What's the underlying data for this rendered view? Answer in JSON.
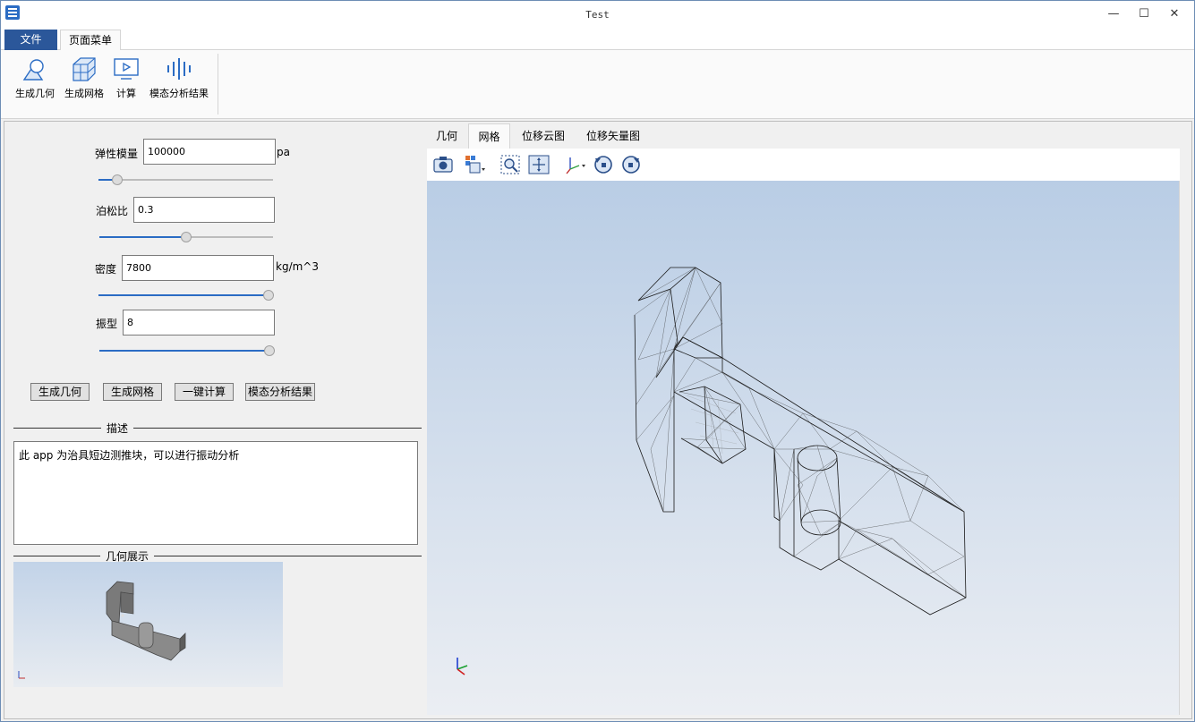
{
  "window": {
    "title": "Test"
  },
  "title_buttons": {
    "minimize": "—",
    "maximize": "☐",
    "close": "✕"
  },
  "menu": {
    "file": "文件",
    "page_menu": "页面菜单"
  },
  "ribbon": {
    "items": [
      {
        "label": "生成几何",
        "icon": "geometry-icon"
      },
      {
        "label": "生成网格",
        "icon": "mesh-icon"
      },
      {
        "label": "计算",
        "icon": "compute-icon"
      },
      {
        "label": "模态分析结果",
        "icon": "modal-result-icon"
      }
    ]
  },
  "params": {
    "elastic_modulus": {
      "label": "弹性模量",
      "value": "100000",
      "unit": "pa",
      "slider_fraction": 0.08
    },
    "poisson_ratio": {
      "label": "泊松比",
      "value": "0.3",
      "slider_fraction": 0.5
    },
    "density": {
      "label": "密度",
      "value": "7800",
      "unit": "kg/m^3",
      "slider_fraction": 1.0
    },
    "mode_shape": {
      "label": "振型",
      "value": "8",
      "slider_fraction": 1.0
    }
  },
  "actions": {
    "gen_geometry": "生成几何",
    "gen_mesh": "生成网格",
    "one_click_compute": "一键计算",
    "modal_result": "模态分析结果"
  },
  "description": {
    "title": "描述",
    "text": "此 app 为治具短边测推块，可以进行振动分析"
  },
  "geometry_preview": {
    "title": "几何展示"
  },
  "view_tabs": [
    {
      "label": "几何",
      "active": false
    },
    {
      "label": "网格",
      "active": true
    },
    {
      "label": "位移云图",
      "active": false
    },
    {
      "label": "位移矢量图",
      "active": false
    }
  ],
  "toolbar_icons": [
    "camera-icon",
    "view-cube-icon",
    "zoom-box-icon",
    "fit-all-icon",
    "axis-orientation-icon",
    "rotate-left-icon",
    "rotate-right-icon"
  ],
  "colors": {
    "accent": "#2b579a",
    "slider": "#2b6cc4",
    "viewport_top": "#b9cde5",
    "viewport_bottom": "#ebeef3"
  }
}
